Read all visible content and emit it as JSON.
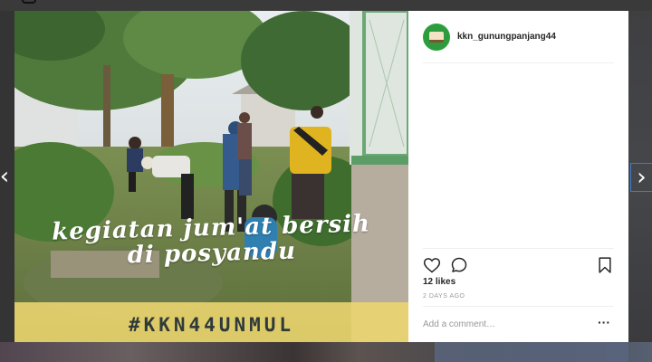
{
  "post": {
    "username": "kkn_gunungpanjang44",
    "caption_line1": "kegiatan jum'at bersih",
    "caption_line2": "di posyandu",
    "hashtag": "#KKN44UNMUL",
    "likes": "12 likes",
    "timestamp": "2 DAYS AGO"
  },
  "comment": {
    "placeholder": "Add a comment…"
  },
  "controls": {
    "prev_glyph": "‹",
    "next_glyph": "›",
    "more_glyph": "···"
  },
  "icons": [
    "heart-icon",
    "comment-icon",
    "bookmark-icon",
    "more-options-icon",
    "chevron-left-icon",
    "chevron-right-icon"
  ],
  "colors": {
    "avatar_ring": "#2aa13c",
    "hashtag_band": "#eed670",
    "backdrop": "#343434"
  }
}
